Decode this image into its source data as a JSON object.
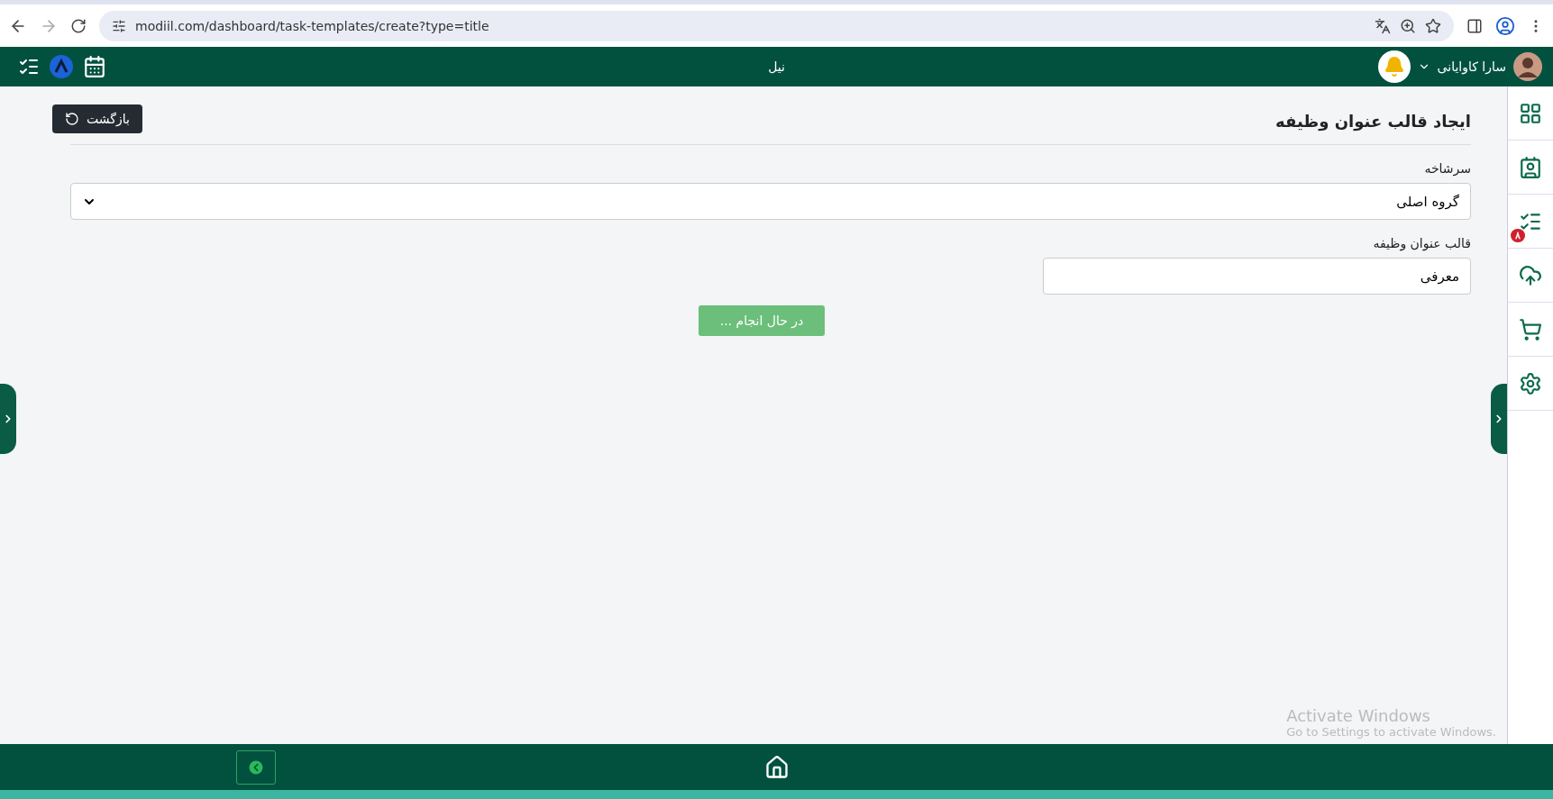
{
  "browser": {
    "url": "modiil.com/dashboard/task-templates/create?type=title"
  },
  "header": {
    "title": "نیل",
    "user_name": "سارا کاوایانی"
  },
  "page": {
    "title": "ایجاد قالب عنوان وظیفه",
    "back_button": "بازگشت",
    "fields": [
      {
        "kind": "select",
        "label": "سرشاخه",
        "value": "گروه اصلی"
      },
      {
        "kind": "text",
        "label": "قالب عنوان وظیفه",
        "value": "معرفی"
      }
    ],
    "submit_button": {
      "label": "در حال انجام ...",
      "disabled": true
    }
  },
  "sidebar": {
    "items": [
      {
        "kind": "grid"
      },
      {
        "kind": "contacts"
      },
      {
        "kind": "tasks",
        "badge": "۸"
      },
      {
        "kind": "upload"
      },
      {
        "kind": "cart"
      },
      {
        "kind": "settings"
      }
    ]
  },
  "os_notice": [
    "Activate Windows",
    "Go to Settings to activate Windows."
  ]
}
